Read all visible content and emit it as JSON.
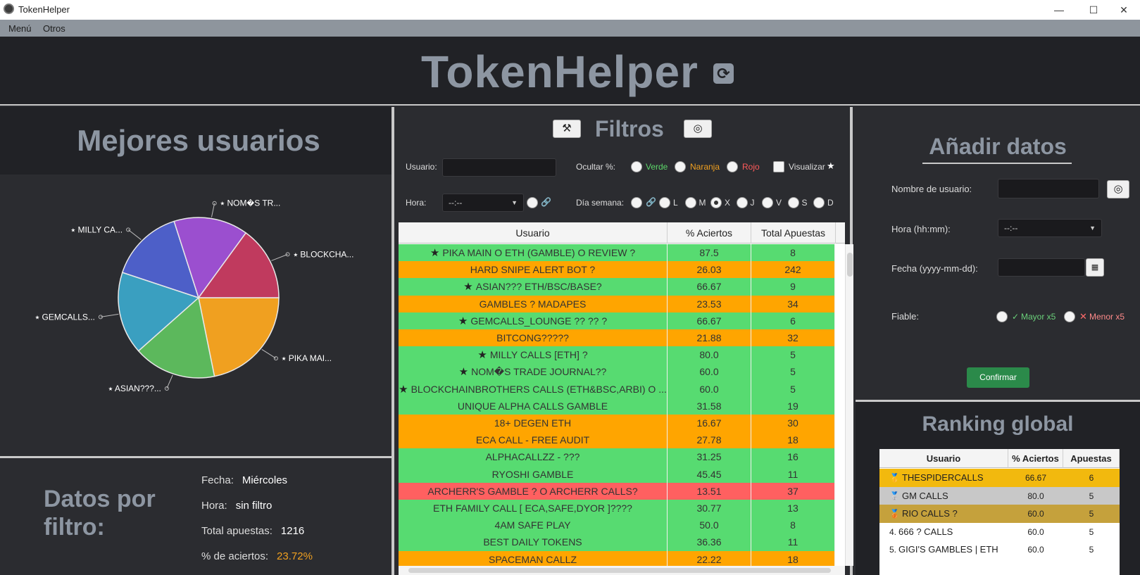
{
  "window": {
    "title": "TokenHelper",
    "minimize": "—",
    "maximize": "☐",
    "close": "✕"
  },
  "menu": {
    "items": [
      "Menú",
      "Otros"
    ]
  },
  "header": {
    "title": "TokenHelper",
    "refresh_icon": "refresh-icon"
  },
  "best_users": {
    "title": "Mejores usuarios",
    "slice_labels": [
      "⭑ PIKA MAI...",
      "⭑ ASIAN???...",
      "⭑ GEMCALLS...",
      "⭑ MILLY CA...",
      "⭑ NOM�S TR...",
      "⭑ BLOCKCHA..."
    ]
  },
  "chart_data": {
    "type": "pie",
    "categories": [
      "⭑ PIKA MAI...",
      "⭑ ASIAN???...",
      "⭑ GEMCALLS...",
      "⭑ MILLY CA...",
      "⭑ NOM�S TR...",
      "⭑ BLOCKCHA..."
    ],
    "values": [
      87.5,
      66.67,
      66.67,
      60.0,
      60.0,
      60.0
    ],
    "colors": [
      "#f0a020",
      "#5cb85c",
      "#3a9fc0",
      "#4d5fc8",
      "#9b4fcf",
      "#c03a5e"
    ],
    "legend": "bottom"
  },
  "filter_data": {
    "title": "Datos por filtro:",
    "fecha_label": "Fecha:",
    "fecha_value": "Miércoles",
    "hora_label": "Hora:",
    "hora_value": "sin filtro",
    "total_label": "Total apuestas:",
    "total_value": "1216",
    "pct_label": "% de aciertos:",
    "pct_value": "23.72%"
  },
  "filters": {
    "title": "Filtros",
    "usuario_label": "Usuario:",
    "ocultar_label": "Ocultar %:",
    "verde": "Verde",
    "naranja": "Naranja",
    "rojo": "Rojo",
    "visualizar": "Visualizar",
    "hora_label": "Hora:",
    "hora_value": "--:--",
    "dia_label": "Día semana:",
    "days": [
      "L",
      "M",
      "X",
      "J",
      "V",
      "S",
      "D"
    ],
    "selected_day": "X"
  },
  "table": {
    "headers": [
      "Usuario",
      "% Aciertos",
      "Total Apuestas"
    ],
    "rows": [
      {
        "fav": true,
        "name": "PIKA MAIN O ETH (GAMBLE) O REVIEW ?",
        "pct": "87.5",
        "total": "8",
        "color": "green"
      },
      {
        "fav": false,
        "name": "HARD SNIPE ALERT BOT ?",
        "pct": "26.03",
        "total": "242",
        "color": "orange"
      },
      {
        "fav": true,
        "name": "ASIAN??? ETH/BSC/BASE?",
        "pct": "66.67",
        "total": "9",
        "color": "green"
      },
      {
        "fav": false,
        "name": "GAMBLES ? MADAPES",
        "pct": "23.53",
        "total": "34",
        "color": "orange"
      },
      {
        "fav": true,
        "name": "GEMCALLS_LOUNGE ?? ?? ?",
        "pct": "66.67",
        "total": "6",
        "color": "green"
      },
      {
        "fav": false,
        "name": "BITCONG?????",
        "pct": "21.88",
        "total": "32",
        "color": "orange"
      },
      {
        "fav": true,
        "name": "MILLY CALLS [ETH] ?",
        "pct": "80.0",
        "total": "5",
        "color": "green"
      },
      {
        "fav": true,
        "name": "NOM�S TRADE JOURNAL??",
        "pct": "60.0",
        "total": "5",
        "color": "green"
      },
      {
        "fav": true,
        "name": "BLOCKCHAINBROTHERS CALLS (ETH&BSC,ARBI) O ...",
        "pct": "60.0",
        "total": "5",
        "color": "green"
      },
      {
        "fav": false,
        "name": "UNIQUE ALPHA CALLS GAMBLE",
        "pct": "31.58",
        "total": "19",
        "color": "green"
      },
      {
        "fav": false,
        "name": "18+ DEGEN ETH",
        "pct": "16.67",
        "total": "30",
        "color": "orange"
      },
      {
        "fav": false,
        "name": "ECA CALL - FREE AUDIT",
        "pct": "27.78",
        "total": "18",
        "color": "orange"
      },
      {
        "fav": false,
        "name": "ALPHACALLZZ - ???",
        "pct": "31.25",
        "total": "16",
        "color": "green"
      },
      {
        "fav": false,
        "name": "RYOSHI GAMBLE",
        "pct": "45.45",
        "total": "11",
        "color": "green"
      },
      {
        "fav": false,
        "name": "ARCHERR'S GAMBLE ? O ARCHERR CALLS?",
        "pct": "13.51",
        "total": "37",
        "color": "red"
      },
      {
        "fav": false,
        "name": "ETH FAMILY CALL [ ECA,SAFE,DYOR ]????",
        "pct": "30.77",
        "total": "13",
        "color": "green"
      },
      {
        "fav": false,
        "name": "4AM SAFE PLAY",
        "pct": "50.0",
        "total": "8",
        "color": "green"
      },
      {
        "fav": false,
        "name": "BEST DAILY TOKENS",
        "pct": "36.36",
        "total": "11",
        "color": "green"
      },
      {
        "fav": false,
        "name": "SPACEMAN CALLZ",
        "pct": "22.22",
        "total": "18",
        "color": "orange"
      }
    ]
  },
  "add_data": {
    "title": "Añadir datos",
    "nombre_label": "Nombre de usuario:",
    "hora_label": "Hora (hh:mm):",
    "hora_value": "--:--",
    "fecha_label": "Fecha (yyyy-mm-dd):",
    "fiable_label": "Fiable:",
    "mayor": "Mayor x5",
    "menor": "Menor x5",
    "confirm": "Confirmar"
  },
  "ranking": {
    "title": "Ranking global",
    "headers": [
      "Usuario",
      "% Aciertos",
      "Apuestas"
    ],
    "rows": [
      {
        "prefix": "🥇",
        "name": "THESPIDERCALLS",
        "pct": "66.67",
        "bets": "6",
        "style": "gold"
      },
      {
        "prefix": "🥈",
        "name": "GM CALLS",
        "pct": "80.0",
        "bets": "5",
        "style": "silver"
      },
      {
        "prefix": "🥉",
        "name": "RIO CALLS ?",
        "pct": "60.0",
        "bets": "5",
        "style": "bronze"
      },
      {
        "prefix": "4.",
        "name": "666 ? CALLS",
        "pct": "60.0",
        "bets": "5",
        "style": "plain"
      },
      {
        "prefix": "5.",
        "name": "GIGI'S GAMBLES | ETH",
        "pct": "60.0",
        "bets": "5",
        "style": "plain"
      }
    ]
  }
}
